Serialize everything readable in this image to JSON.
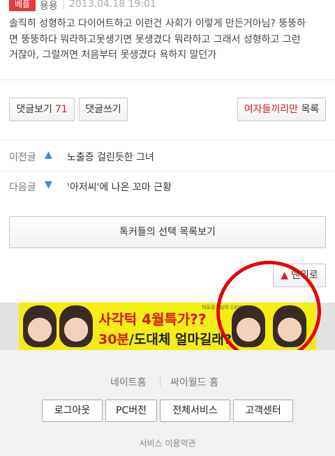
{
  "comment": {
    "badge": "베플",
    "user": "용용",
    "date": "2013.04.18 19:01",
    "text": "솔직히 성형하고 다이어트하고 이런건 사회가 이렇게 만든거아님? 뚱뚱하\n면 뚱뚱하다 뭐라하고못생기면 못생겼다 뭐라하고 그래서 성형하고 그런\n거잖아, 그럴꺼면 처음부터 못생겼다 욕하지 말던가"
  },
  "actions": {
    "view_comments": "댓글보기",
    "comment_count": "71",
    "write_comment": "댓글쓰기",
    "board_name": "여자들끼리만",
    "list": "목록"
  },
  "nav": {
    "prev_label": "이전글",
    "prev_title": "노출증 걸린듯한 그녀",
    "next_label": "다음글",
    "next_title": "'아저씨'에 나온 꼬마 근황"
  },
  "talker_button": "톡커들의 선택 목록보기",
  "top_button": "맨위로",
  "ad": {
    "line1": "사각턱 4월특가??",
    "line2_highlight": "30분",
    "line2_rest": "/도대체 얼마길래?",
    "small": "의료광고심의 1309"
  },
  "footer": {
    "link1": "네이트홈",
    "link2": "싸이월드 홈",
    "buttons": [
      "로그아웃",
      "PC버전",
      "전체서비스",
      "고객센터"
    ],
    "terms": "서비스 이용약관"
  },
  "colors": {
    "accent_red": "#d02020",
    "ad_yellow": "#f4ed16",
    "annotation_circle": "#e60000"
  },
  "icons": {
    "prev": "chevron-up-icon",
    "next": "chevron-down-icon",
    "top": "chevron-up-icon"
  }
}
